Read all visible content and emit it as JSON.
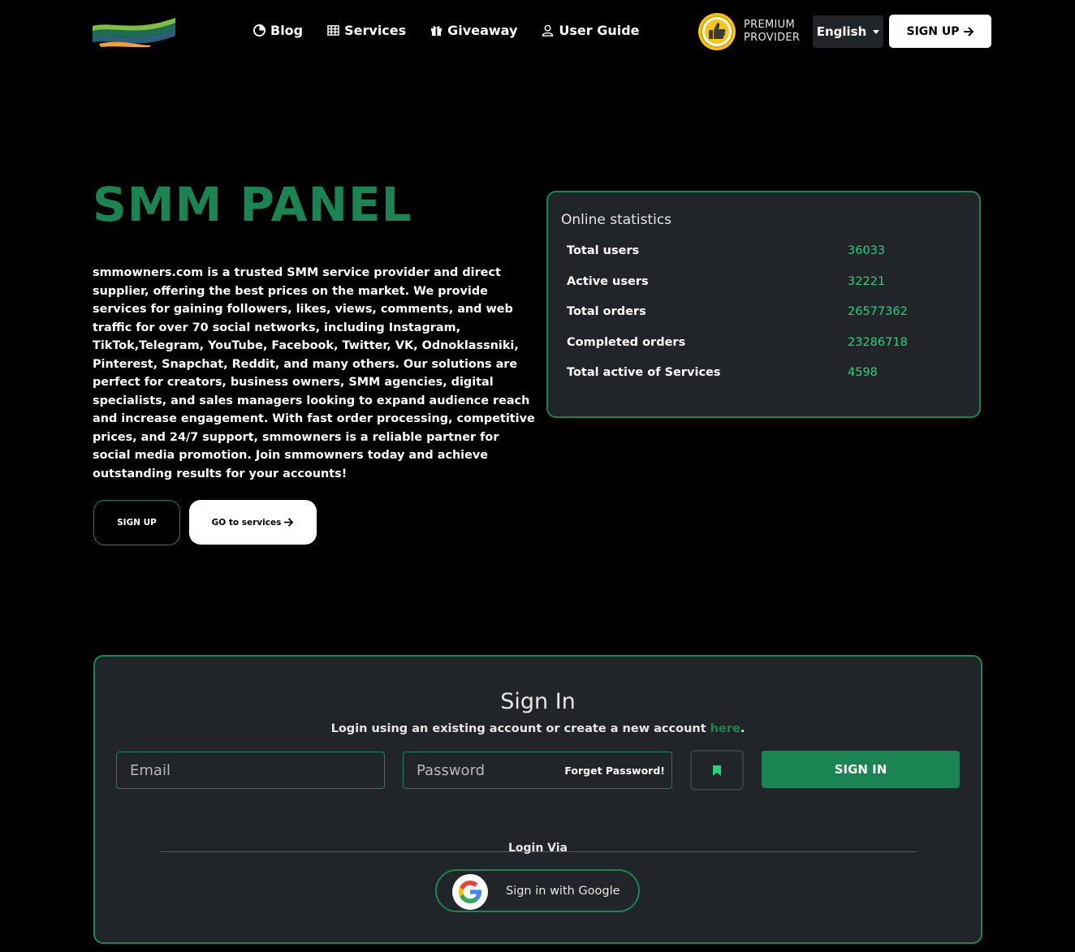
{
  "header": {
    "nav": [
      {
        "label": "Blog",
        "icon": "blog-icon"
      },
      {
        "label": "Services",
        "icon": "grid-icon"
      },
      {
        "label": "Giveaway",
        "icon": "gift-icon"
      },
      {
        "label": "User Guide",
        "icon": "user-icon"
      }
    ],
    "premium_line1": "PREMIUM",
    "premium_line2": "PROVIDER",
    "language": "English",
    "signup_label": "SIGN UP"
  },
  "hero": {
    "title": "SMM PANEL",
    "text": "smmowners.com is a trusted SMM service provider and direct supplier, offering the best prices on the market. We provide services for gaining followers, likes, views, comments, and web traffic for over 70 social networks, including Instagram, TikTok,Telegram, YouTube, Facebook, Twitter, VK, Odnoklassniki, Pinterest, Snapchat, Reddit, and many others. Our solutions are perfect for creators, business owners, SMM agencies, digital specialists, and sales managers looking to expand audience reach and increase engagement. With fast order processing, competitive prices, and 24/7 support, smmowners is a reliable partner for social media promotion. Join smmowners today and achieve outstanding results for your accounts!",
    "signup_label": "SIGN UP",
    "services_label": "GO to services"
  },
  "stats": {
    "title": "Online statistics",
    "rows": [
      {
        "label": "Total users",
        "value": "36033"
      },
      {
        "label": "Active users",
        "value": "32221"
      },
      {
        "label": "Total orders",
        "value": "26577362"
      },
      {
        "label": "Completed orders",
        "value": "23286718"
      },
      {
        "label": "Total active of Services",
        "value": "4598"
      }
    ]
  },
  "signin": {
    "title": "Sign In",
    "subtitle": "Login using an existing account or create a new account ",
    "here": "here",
    "period": ".",
    "email_placeholder": "Email",
    "password_placeholder": "Password",
    "forget_label": "Forget Password!",
    "button_label": "SIGN IN",
    "via_label": "Login Via",
    "google_label": "Sign in with Google"
  },
  "colors": {
    "accent": "#1a8552",
    "stat_value": "#25d17b",
    "panel": "#212529"
  }
}
